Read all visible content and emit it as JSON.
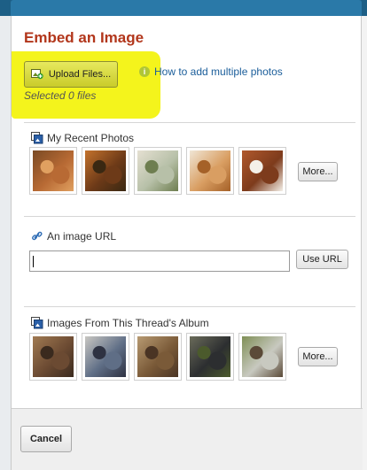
{
  "dialog": {
    "title": "Embed an Image",
    "upload": {
      "button_label": "Upload Files...",
      "selected_text": "Selected 0 files"
    },
    "help_link": "How to add multiple photos",
    "recent": {
      "heading": "My Recent Photos",
      "photos": [
        {
          "name": "eggs-carton-photo",
          "colors": [
            "#b86a34",
            "#7a4a24",
            "#e0a060"
          ]
        },
        {
          "name": "roast-chicken-photo",
          "colors": [
            "#6d3a18",
            "#c4722c",
            "#3a2812"
          ]
        },
        {
          "name": "cut-chicken-photo",
          "colors": [
            "#b7c0a8",
            "#e5e0d2",
            "#6e7e50"
          ]
        },
        {
          "name": "chicken-pieces-photo",
          "colors": [
            "#d99e62",
            "#f0e6d6",
            "#a56128"
          ]
        },
        {
          "name": "brown-eggs-photo",
          "colors": [
            "#7d3b1c",
            "#b0582c",
            "#f4f0e8"
          ]
        }
      ],
      "more_label": "More..."
    },
    "url": {
      "heading": "An image URL",
      "value": "",
      "button_label": "Use URL"
    },
    "album": {
      "heading": "Images From This Thread's Album",
      "photos": [
        {
          "name": "hen-photo-1",
          "colors": [
            "#6b4a32",
            "#a07a52",
            "#3a2a1e"
          ]
        },
        {
          "name": "hen-cage-photo",
          "colors": [
            "#5f6e86",
            "#c9c7c2",
            "#2e3242"
          ]
        },
        {
          "name": "hen-photo-3",
          "colors": [
            "#7a5a38",
            "#b79a72",
            "#4a3424"
          ]
        },
        {
          "name": "black-hen-photo",
          "colors": [
            "#2c2e30",
            "#6a6b5a",
            "#4b5a2c"
          ]
        },
        {
          "name": "hens-grass-photo",
          "colors": [
            "#c8c9c0",
            "#7f8f56",
            "#5b4a38"
          ]
        }
      ],
      "more_label": "More..."
    },
    "footer": {
      "cancel_label": "Cancel"
    }
  },
  "colors": {
    "title": "#b2361b",
    "highlight": "#f3f310",
    "link": "#1a5d9a",
    "header_bar": "#1d5f86"
  }
}
